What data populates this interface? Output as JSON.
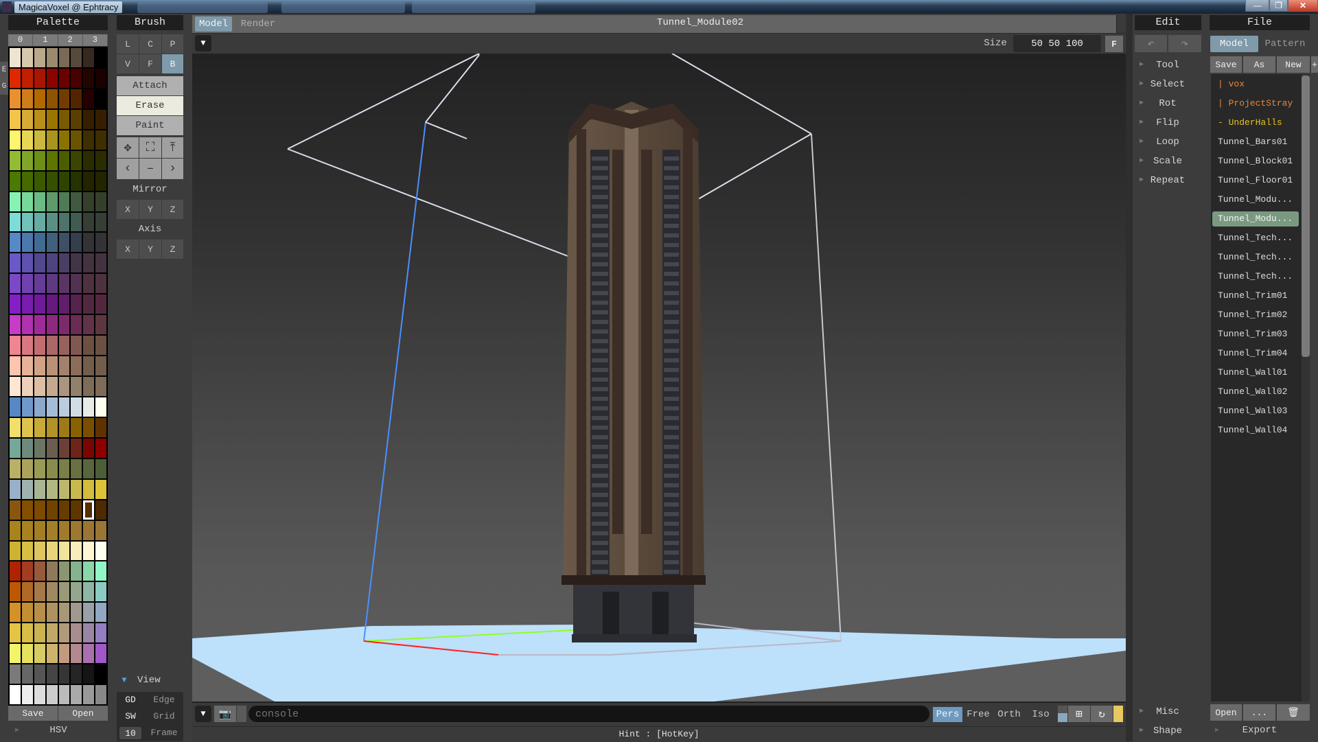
{
  "window": {
    "title": "MagicaVoxel @ Ephtracy",
    "controls": {
      "minimize": "—",
      "maximize": "❐",
      "close": "✕"
    }
  },
  "palette": {
    "header": "Palette",
    "tabs": [
      "0",
      "1",
      "2",
      "3"
    ],
    "side_buttons": [
      "E",
      "G"
    ],
    "colors": [
      "#eee4d2",
      "#d6c8ad",
      "#b8a98c",
      "#9a8b6e",
      "#7a6a55",
      "#574a3c",
      "#37291f",
      "#000000",
      "#df2800",
      "#c02000",
      "#a81500",
      "#8a0300",
      "#6a0000",
      "#480000",
      "#230500",
      "#1a0000",
      "#ea912e",
      "#cf7c1a",
      "#b36900",
      "#905300",
      "#723c00",
      "#522500",
      "#250000",
      "#000000",
      "#f2c54a",
      "#d7ab37",
      "#b98e1b",
      "#9a7500",
      "#7a5a00",
      "#5a3f00",
      "#361f00",
      "#361f00",
      "#fff46e",
      "#e7d754",
      "#ccb83d",
      "#a9941e",
      "#8b7300",
      "#6a5400",
      "#3f2e00",
      "#3f2e00",
      "#93bc33",
      "#80a628",
      "#6d8f16",
      "#5e7500",
      "#4a5e00",
      "#3c4500",
      "#2b2d00",
      "#2b2d00",
      "#4a7a00",
      "#456a00",
      "#3b5a00",
      "#355000",
      "#2e4400",
      "#243300",
      "#222500",
      "#222500",
      "#88f2b2",
      "#78d89a",
      "#6bbb84",
      "#5e9a6a",
      "#4f7c54",
      "#405a40",
      "#35402b",
      "#35402b",
      "#7ddcd6",
      "#70c2bb",
      "#66aca3",
      "#5a8f86",
      "#4e7369",
      "#405b50",
      "#363e36",
      "#363e36",
      "#5689c8",
      "#4d78ac",
      "#436a93",
      "#42607e",
      "#3d5065",
      "#353e4c",
      "#333336",
      "#333336",
      "#6958c8",
      "#5d52ad",
      "#52488e",
      "#4e4480",
      "#4a3e65",
      "#433548",
      "#433240",
      "#433240",
      "#7b48c8",
      "#7042ae",
      "#653c98",
      "#5e3a80",
      "#583562",
      "#513250",
      "#4e323f",
      "#4e323f",
      "#841fc8",
      "#7a1cae",
      "#6f1a98",
      "#661a80",
      "#601e6b",
      "#56224e",
      "#53283f",
      "#53283f",
      "#c83ac8",
      "#b032ae",
      "#9d2c98",
      "#8d2a80",
      "#7d2a6b",
      "#6a2c55",
      "#623348",
      "#5e3640",
      "#ee8590",
      "#d97880",
      "#c26e70",
      "#ab6868",
      "#98625c",
      "#815850",
      "#6b5043",
      "#6b5043",
      "#fec4ae",
      "#e6b39a",
      "#d1a386",
      "#b99177",
      "#a3826b",
      "#8b6d5a",
      "#735d4b",
      "#735d4b",
      "#ffe6d3",
      "#efd1bb",
      "#dbbea3",
      "#c4a990",
      "#ac957e",
      "#928169",
      "#7e6b58",
      "#7e6b58",
      "#5787c5",
      "#7198cb",
      "#8aa9cd",
      "#a3bdd8",
      "#b9cdde",
      "#d0dde5",
      "#e7ece7",
      "#fffff0",
      "#f2de6a",
      "#dec44f",
      "#c8aa38",
      "#b39227",
      "#9e7a17",
      "#8a6100",
      "#7a4e00",
      "#603200",
      "#74a999",
      "#6c8b7c",
      "#6a7662",
      "#6b5e50",
      "#6c4038",
      "#6e2418",
      "#7a0600",
      "#8c0000",
      "#bab165",
      "#aaa35b",
      "#9b9a55",
      "#888d4e",
      "#797f47",
      "#697143",
      "#59653c",
      "#4c5e37",
      "#98b0ca",
      "#a0b2b0",
      "#a9b695",
      "#b2b781",
      "#bdb66d",
      "#c8b94e",
      "#d3bc3c",
      "#dcc13a",
      "#8a560e",
      "#835000",
      "#7c4a00",
      "#714300",
      "#663c00",
      "#5d3600",
      "#553000",
      "#4e2a00",
      "#a9841b",
      "#a88221",
      "#a47e25",
      "#a37f29",
      "#a07b2c",
      "#9e7830",
      "#9b7533",
      "#997536",
      "#ceb332",
      "#d6bf44",
      "#dec560",
      "#e8d57a",
      "#f2e39a",
      "#f8ecbc",
      "#fff7d4",
      "#fffff0",
      "#b02200",
      "#a33d22",
      "#975b3c",
      "#8e7a5a",
      "#8a9670",
      "#86b38d",
      "#89d7a8",
      "#92f5c8",
      "#bd5800",
      "#b06a26",
      "#a5794a",
      "#9f8862",
      "#9a9a78",
      "#93a68e",
      "#8eb6a4",
      "#8ccac4",
      "#d39126",
      "#c38f35",
      "#b88f48",
      "#b09260",
      "#a89878",
      "#a09a8e",
      "#9aa0a8",
      "#90a8c0",
      "#e4c444",
      "#d8bd48",
      "#c9b353",
      "#c0a866",
      "#b09a7a",
      "#a88c8e",
      "#9a86a4",
      "#927ec0",
      "#f2f46a",
      "#e6e15e",
      "#d6cc64",
      "#ceb36c",
      "#c29a7e",
      "#b48890",
      "#a870ae",
      "#a058c6",
      "#7a7a7a",
      "#666666",
      "#555555",
      "#454545",
      "#353535",
      "#252525",
      "#151515",
      "#000000",
      "#ffffff",
      "#eeeeee",
      "#dddddd",
      "#cccccc",
      "#bbbbbb",
      "#aaaaaa",
      "#999999",
      "#888888"
    ],
    "selected_index": 182,
    "save_label": "Save",
    "open_label": "Open",
    "hsv_label": "HSV"
  },
  "brush": {
    "header": "Brush",
    "type_buttons": [
      "L",
      "C",
      "P",
      "V",
      "F",
      "B"
    ],
    "active_type": "B",
    "modes": [
      "Attach",
      "Erase",
      "Paint"
    ],
    "active_mode": "Erase",
    "tool_icons": [
      "move-icon",
      "select-box-icon",
      "lift-icon",
      "prev-icon",
      "minus-icon",
      "next-icon"
    ],
    "tool_glyphs": [
      "✥",
      "⛶",
      "⤒",
      "‹",
      "–",
      "›"
    ],
    "mirror_label": "Mirror",
    "mirror_buttons": [
      "X",
      "Y",
      "Z"
    ],
    "axis_label": "Axis",
    "axis_buttons": [
      "X",
      "Y",
      "Z"
    ],
    "view": {
      "label": "View",
      "rows": [
        {
          "key": "GD",
          "label": "Edge"
        },
        {
          "key": "SW",
          "label": "Grid"
        },
        {
          "key": "10",
          "label": "Frame"
        }
      ]
    }
  },
  "viewport": {
    "tabs": [
      "Model",
      "Render"
    ],
    "active_tab": "Model",
    "model_name": "Tunnel_Module02",
    "size_label": "Size",
    "size_value": "50 50 100",
    "fit_button": "F",
    "console_placeholder": "console",
    "camera_modes": [
      "Pers",
      "Free",
      "Orth",
      "Iso"
    ],
    "active_camera": "Pers",
    "hint": "Hint : [HotKey]",
    "colors": {
      "ground": "#bde0fb",
      "x_axis": "#ff2020",
      "y_axis": "#90ff20",
      "z_axis": "#4a90ff",
      "bounds": "#d8d8e8"
    }
  },
  "edit": {
    "header": "Edit",
    "undo": "↶",
    "redo": "↷",
    "items": [
      "Tool",
      "Select",
      "Rot",
      "Flip",
      "Loop",
      "Scale",
      "Repeat"
    ],
    "bottom_items": [
      "Misc",
      "Shape"
    ]
  },
  "file": {
    "header": "File",
    "tabs": [
      "Model",
      "Pattern"
    ],
    "active_tab": "Model",
    "actions": [
      "Save",
      "As",
      "New",
      "+"
    ],
    "entries": [
      {
        "name": "| vox",
        "kind": "folder"
      },
      {
        "name": "| ProjectStray",
        "kind": "folder"
      },
      {
        "name": "- UnderHalls",
        "kind": "current-folder"
      },
      {
        "name": "Tunnel_Bars01",
        "kind": "file"
      },
      {
        "name": "Tunnel_Block01",
        "kind": "file"
      },
      {
        "name": "Tunnel_Floor01",
        "kind": "file"
      },
      {
        "name": "Tunnel_Modu...",
        "kind": "file"
      },
      {
        "name": "Tunnel_Modu...",
        "kind": "file",
        "selected": true
      },
      {
        "name": "Tunnel_Tech...",
        "kind": "file"
      },
      {
        "name": "Tunnel_Tech...",
        "kind": "file"
      },
      {
        "name": "Tunnel_Tech...",
        "kind": "file"
      },
      {
        "name": "Tunnel_Trim01",
        "kind": "file"
      },
      {
        "name": "Tunnel_Trim02",
        "kind": "file"
      },
      {
        "name": "Tunnel_Trim03",
        "kind": "file"
      },
      {
        "name": "Tunnel_Trim04",
        "kind": "file"
      },
      {
        "name": "Tunnel_Wall01",
        "kind": "file"
      },
      {
        "name": "Tunnel_Wall02",
        "kind": "file"
      },
      {
        "name": "Tunnel_Wall03",
        "kind": "file"
      },
      {
        "name": "Tunnel_Wall04",
        "kind": "file"
      }
    ],
    "bottom_actions": [
      "Open",
      "...",
      "🗑"
    ],
    "export_label": "Export",
    "colors": {
      "folder": "#e8873a",
      "current_folder": "#e8c020",
      "selected_bg": "#7a9a80"
    }
  }
}
